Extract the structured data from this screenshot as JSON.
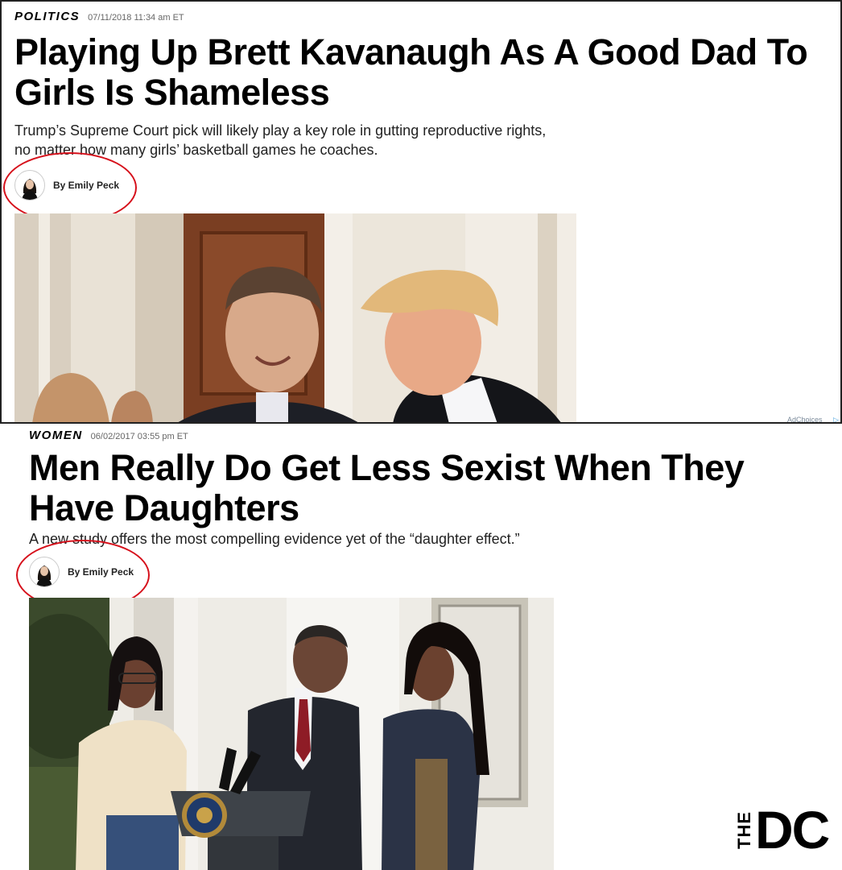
{
  "articles": [
    {
      "section": "POLITICS",
      "date": "07/11/2018 11:34 am ET",
      "headline": "Playing Up Brett Kavanaugh As A Good Dad To Girls Is Shameless",
      "dek": "Trump’s Supreme Court pick will likely play a key role in gutting reproductive rights, no matter how many girls’ basketball games he coaches.",
      "byline": "By Emily Peck",
      "ad_label": "AdChoices"
    },
    {
      "section": "WOMEN",
      "date": "06/02/2017 03:55 pm ET",
      "headline": "Men Really Do Get Less Sexist When They Have Daughters",
      "dek": "A new study offers the most compelling evidence yet of the “daughter effect.”",
      "byline": "By Emily Peck"
    }
  ],
  "logo": {
    "the": "THE",
    "dc": "DC"
  },
  "colors": {
    "annotation": "#d6101b"
  }
}
